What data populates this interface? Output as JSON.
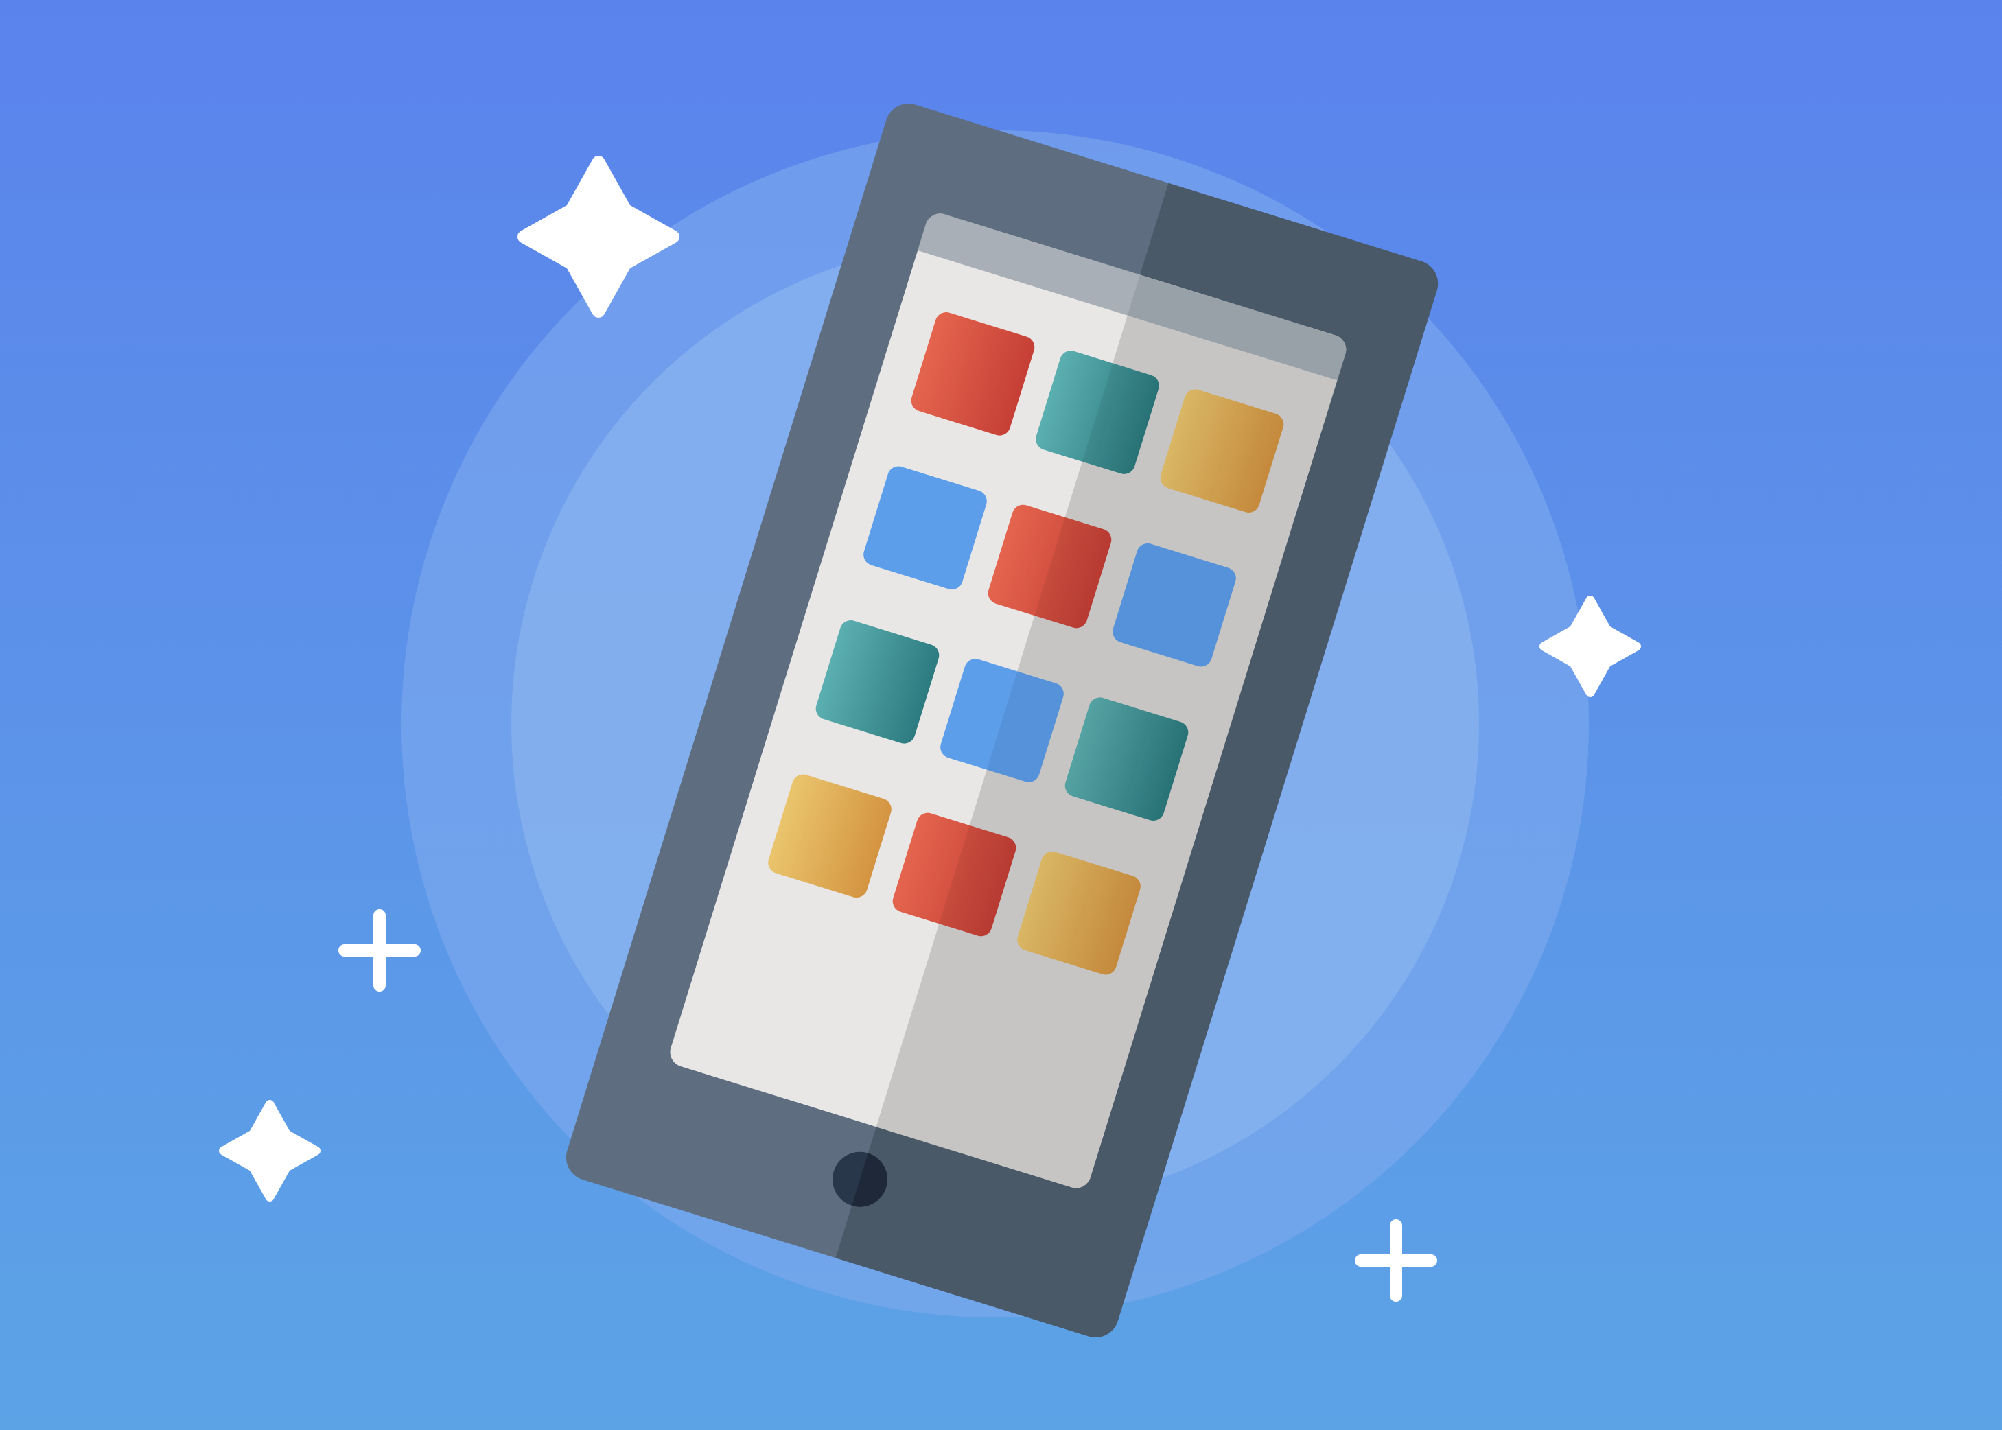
{
  "illustration": {
    "subject": "tablet-with-app-grid",
    "colors": {
      "background_top": "#5B83EC",
      "background_bottom": "#5CA3E6",
      "halo_outer": "#7FAAEE",
      "halo_inner": "#8DB8F0",
      "tablet_body_light": "#5E6E80",
      "tablet_body_dark": "#4A5968",
      "screen_light": "#E8E7E6",
      "screen_shadow": "#D5D4D2",
      "status_bar": "#A9AFB6",
      "home_button": "#29374B",
      "sparkle": "#FFFFFF"
    },
    "app_icons": [
      {
        "name": "app-icon-red",
        "gradient": [
          "#E4654E",
          "#C63F36"
        ]
      },
      {
        "name": "app-icon-teal",
        "gradient": [
          "#5CAFB0",
          "#2C7B80"
        ]
      },
      {
        "name": "app-icon-gold",
        "gradient": [
          "#EAC56D",
          "#D49441"
        ]
      },
      {
        "name": "app-icon-blue",
        "gradient": [
          "#5C9EEA",
          "#5C9EEA"
        ]
      },
      {
        "name": "app-icon-red",
        "gradient": [
          "#E4654E",
          "#C63F36"
        ]
      },
      {
        "name": "app-icon-blue",
        "gradient": [
          "#5C9EEA",
          "#5C9EEA"
        ]
      },
      {
        "name": "app-icon-teal",
        "gradient": [
          "#5CAFB0",
          "#2C7B80"
        ]
      },
      {
        "name": "app-icon-blue",
        "gradient": [
          "#5C9EEA",
          "#5C9EEA"
        ]
      },
      {
        "name": "app-icon-teal",
        "gradient": [
          "#5CAFB0",
          "#2C7B80"
        ]
      },
      {
        "name": "app-icon-gold",
        "gradient": [
          "#EAC56D",
          "#D49441"
        ]
      },
      {
        "name": "app-icon-red",
        "gradient": [
          "#E4654E",
          "#C63F36"
        ]
      },
      {
        "name": "app-icon-gold",
        "gradient": [
          "#EAC56D",
          "#D49441"
        ]
      }
    ],
    "decorations": [
      "sparkle-icon",
      "sparkle-icon",
      "sparkle-icon",
      "plus-icon",
      "plus-icon"
    ]
  }
}
